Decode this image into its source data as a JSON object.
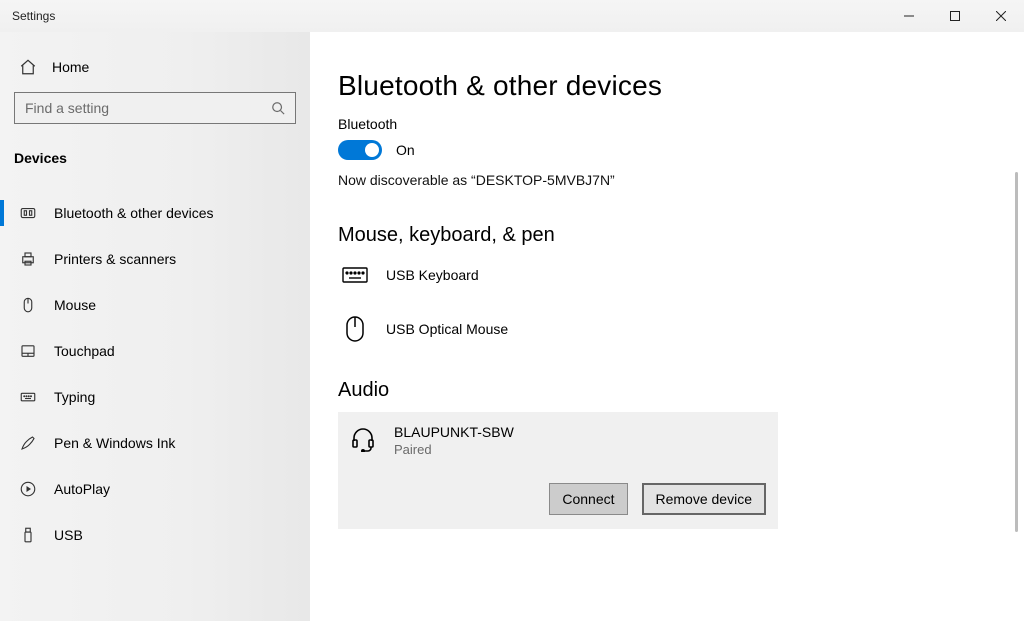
{
  "window": {
    "title": "Settings"
  },
  "sidebar": {
    "home_label": "Home",
    "search_placeholder": "Find a setting",
    "section_label": "Devices",
    "items": [
      {
        "label": "Bluetooth & other devices",
        "icon": "bluetooth-devices",
        "active": true
      },
      {
        "label": "Printers & scanners",
        "icon": "printer",
        "active": false
      },
      {
        "label": "Mouse",
        "icon": "mouse",
        "active": false
      },
      {
        "label": "Touchpad",
        "icon": "touchpad",
        "active": false
      },
      {
        "label": "Typing",
        "icon": "keyboard",
        "active": false
      },
      {
        "label": "Pen & Windows Ink",
        "icon": "pen",
        "active": false
      },
      {
        "label": "AutoPlay",
        "icon": "autoplay",
        "active": false
      },
      {
        "label": "USB",
        "icon": "usb",
        "active": false
      }
    ]
  },
  "page": {
    "title": "Bluetooth & other devices",
    "bluetooth": {
      "heading": "Bluetooth",
      "state_label": "On",
      "on": true,
      "discoverable_text": "Now discoverable as “DESKTOP-5MVBJ7N”"
    },
    "groups": {
      "mkp": {
        "title": "Mouse, keyboard, & pen",
        "devices": [
          {
            "name": "USB Keyboard",
            "icon": "keyboard"
          },
          {
            "name": "USB Optical Mouse",
            "icon": "mouse"
          }
        ]
      },
      "audio": {
        "title": "Audio",
        "device": {
          "name": "BLAUPUNKT-SBW",
          "status": "Paired",
          "icon": "headset",
          "connect_label": "Connect",
          "remove_label": "Remove device"
        }
      }
    }
  }
}
